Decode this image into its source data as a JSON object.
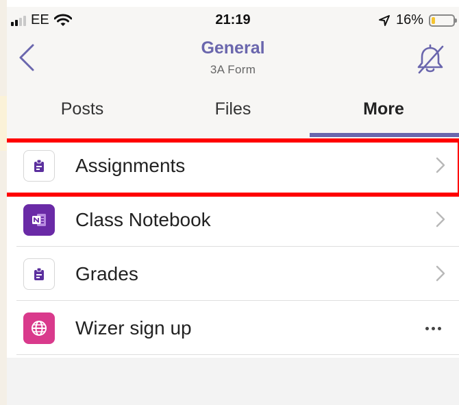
{
  "status_bar": {
    "carrier": "EE",
    "time": "21:19",
    "battery_percent": "16%",
    "battery_level": 0.16,
    "icons": [
      "signal-icon",
      "wifi-icon",
      "location-icon",
      "battery-icon"
    ]
  },
  "header": {
    "title": "General",
    "subtitle": "3A Form",
    "back_icon": "chevron-left-icon",
    "notification_icon": "bell-off-icon"
  },
  "tabs": [
    {
      "label": "Posts",
      "active": false
    },
    {
      "label": "Files",
      "active": false
    },
    {
      "label": "More",
      "active": true
    }
  ],
  "list": {
    "items": [
      {
        "label": "Assignments",
        "icon": "assignments-icon",
        "trailing": "chevron-right-icon",
        "highlighted": true
      },
      {
        "label": "Class Notebook",
        "icon": "onenote-icon",
        "trailing": "chevron-right-icon",
        "highlighted": false
      },
      {
        "label": "Grades",
        "icon": "grades-icon",
        "trailing": "chevron-right-icon",
        "highlighted": false
      },
      {
        "label": "Wizer sign up",
        "icon": "globe-icon",
        "trailing": "more-icon",
        "highlighted": false
      }
    ]
  },
  "colors": {
    "accent": "#6a66ad",
    "highlight": "#ff0000",
    "onenote_purple": "#6a2aa6",
    "wizer_pink": "#d93a8c",
    "battery_yellow": "#f4c431"
  }
}
